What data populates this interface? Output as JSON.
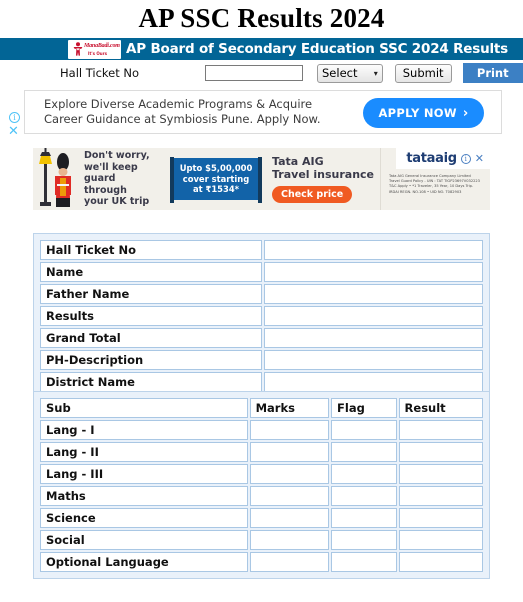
{
  "page": {
    "title": "AP SSC Results 2024"
  },
  "board_header": {
    "title": "AP Board of Secondary Education SSC 2024 Results",
    "logo": {
      "name": "manabadi-logo",
      "word": "ManaBadi.com",
      "sub": "It's Ours"
    },
    "bar_color": "#026596"
  },
  "form": {
    "hall_ticket_label": "Hall Ticket No",
    "hall_ticket_value": "",
    "hall_ticket_placeholder": "",
    "select_value": "Select",
    "submit_label": "Submit",
    "print_label": "Print",
    "print_color": "#3c80c4"
  },
  "ad_top": {
    "line1": "Explore Diverse Academic Programs & Acquire",
    "line2": "Career Guidance at Symbiosis Pune. Apply Now.",
    "cta": "APPLY NOW",
    "cta_arrow": "›",
    "cta_color": "#1a8cff",
    "info_glyph": "i",
    "close_glyph": "✕"
  },
  "ad_bottom": {
    "headline_line1": "Don't worry,",
    "headline_line2": "we'll keep guard",
    "headline_line3": "through",
    "headline_line4": "your UK trip",
    "banner_line1": "Upto $5,00,000",
    "banner_line2": "cover starting",
    "banner_line3": "at ₹1534*",
    "brand_line1": "Tata AIG",
    "brand_line2": "Travel insurance",
    "cta": "Check price",
    "logo_text": "tataaig",
    "info_glyph": "i",
    "close_glyph": "✕",
    "fine_line1": "Tata AIG General Insurance Company Limited",
    "fine_line2": "Travel Guard Policy - UIN : TAT TIGP23697V032223",
    "fine_line3": "T&C Apply  •  *1 Traveler, 35 Year, 10 Days Trip.",
    "fine_line4": "IRDAI REGN. NO.108  •  UID NO. T082903",
    "banner_color": "#1263a8",
    "cta_color": "#f05a22"
  },
  "result_table": {
    "rows": [
      {
        "label": "Hall Ticket No",
        "value": ""
      },
      {
        "label": "Name",
        "value": ""
      },
      {
        "label": "Father Name",
        "value": ""
      },
      {
        "label": "Results",
        "value": ""
      },
      {
        "label": "Grand Total",
        "value": ""
      },
      {
        "label": "PH-Description",
        "value": ""
      },
      {
        "label": "District Name",
        "value": ""
      }
    ]
  },
  "subject_table": {
    "headers": [
      "Sub",
      "Marks",
      "Flag",
      "Result"
    ],
    "rows": [
      {
        "subject": "Lang - I",
        "marks": "",
        "flag": "",
        "result": ""
      },
      {
        "subject": "Lang - II",
        "marks": "",
        "flag": "",
        "result": ""
      },
      {
        "subject": "Lang - III",
        "marks": "",
        "flag": "",
        "result": ""
      },
      {
        "subject": "Maths",
        "marks": "",
        "flag": "",
        "result": ""
      },
      {
        "subject": "Science",
        "marks": "",
        "flag": "",
        "result": ""
      },
      {
        "subject": "Social",
        "marks": "",
        "flag": "",
        "result": ""
      },
      {
        "subject": "Optional Language",
        "marks": "",
        "flag": "",
        "result": ""
      }
    ]
  }
}
